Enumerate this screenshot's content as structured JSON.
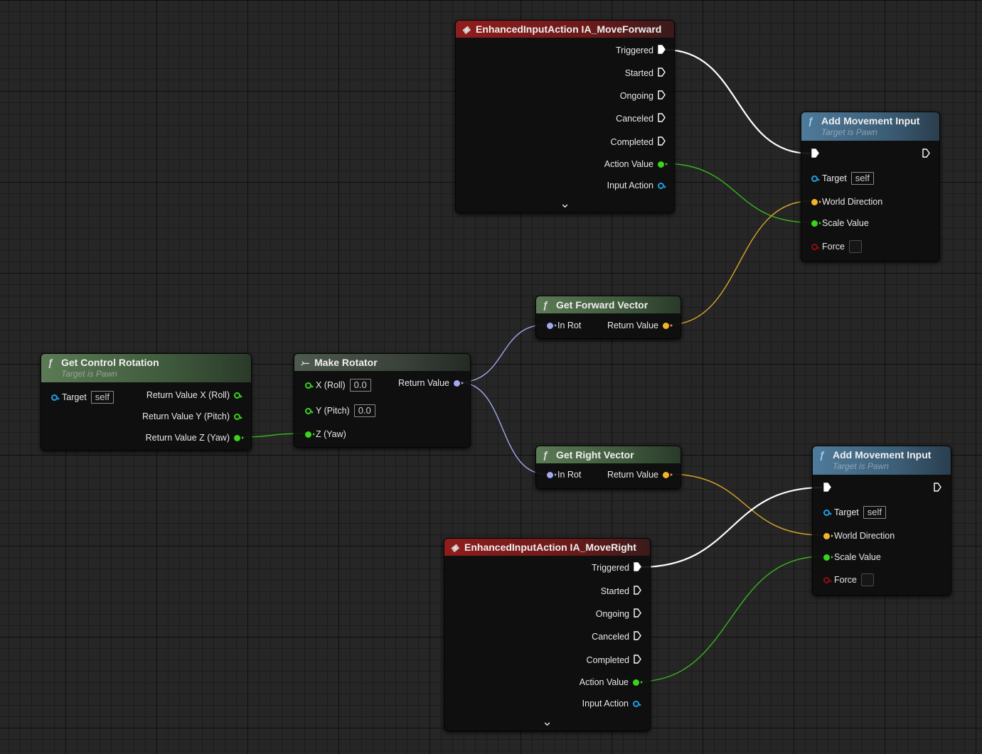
{
  "colors": {
    "exec": "#ffffff",
    "float": "#39d41c",
    "vector": "#f5b428",
    "rotator": "#a0a8f0",
    "object": "#1e9fe6",
    "bool": "#8c0f0f",
    "event_header": "#8f1d1d",
    "function_header_green": "#5b7a55",
    "function_header_blue": "#4f7a99",
    "struct_header": "#4d5a4d"
  },
  "nodes": [
    {
      "id": "move_forward",
      "kind": "event",
      "title": "EnhancedInputAction IA_MoveForward",
      "icon": "event-diamond-icon",
      "expandable": true,
      "pins": [
        {
          "dir": "out",
          "type": "exec",
          "label": "Triggered",
          "connected": true
        },
        {
          "dir": "out",
          "type": "exec",
          "label": "Started"
        },
        {
          "dir": "out",
          "type": "exec",
          "label": "Ongoing"
        },
        {
          "dir": "out",
          "type": "exec",
          "label": "Canceled"
        },
        {
          "dir": "out",
          "type": "exec",
          "label": "Completed"
        },
        {
          "dir": "out",
          "type": "float",
          "label": "Action Value",
          "connected": true
        },
        {
          "dir": "out",
          "type": "object",
          "label": "Input Action"
        }
      ]
    },
    {
      "id": "add_move_1",
      "kind": "func_blue",
      "title": "Add Movement Input",
      "subtitle": "Target is Pawn",
      "icon": "function-icon",
      "pins": [
        {
          "dir": "in",
          "type": "exec",
          "label": "",
          "connected": true
        },
        {
          "dir": "out",
          "type": "exec",
          "label": ""
        },
        {
          "dir": "in",
          "type": "object",
          "label": "Target",
          "default": "self"
        },
        {
          "dir": "in",
          "type": "vector",
          "label": "World Direction",
          "connected": true
        },
        {
          "dir": "in",
          "type": "float",
          "label": "Scale Value",
          "connected": true
        },
        {
          "dir": "in",
          "type": "bool",
          "label": "Force",
          "checkbox": true
        }
      ]
    },
    {
      "id": "fwd_vec",
      "kind": "func_green",
      "title": "Get Forward Vector",
      "icon": "function-icon",
      "pins": [
        {
          "dir": "in",
          "type": "rotator",
          "label": "In Rot",
          "connected": true
        },
        {
          "dir": "out",
          "type": "vector",
          "label": "Return Value",
          "connected": true
        }
      ]
    },
    {
      "id": "ctrl_rot",
      "kind": "func_green",
      "title": "Get Control Rotation",
      "subtitle": "Target is Pawn",
      "icon": "function-icon",
      "pins": [
        {
          "dir": "in",
          "type": "object",
          "label": "Target",
          "default": "self"
        },
        {
          "dir": "out",
          "type": "float",
          "label": "Return Value X (Roll)"
        },
        {
          "dir": "out",
          "type": "float",
          "label": "Return Value Y (Pitch)"
        },
        {
          "dir": "out",
          "type": "float",
          "label": "Return Value Z (Yaw)",
          "connected": true
        }
      ]
    },
    {
      "id": "make_rot",
      "kind": "struct",
      "title": "Make Rotator",
      "icon": "make-struct-icon",
      "pins": [
        {
          "dir": "in",
          "type": "float",
          "label": "X (Roll)",
          "default": "0.0"
        },
        {
          "dir": "in",
          "type": "float",
          "label": "Y (Pitch)",
          "default": "0.0"
        },
        {
          "dir": "in",
          "type": "float",
          "label": "Z (Yaw)",
          "connected": true
        },
        {
          "dir": "out",
          "type": "rotator",
          "label": "Return Value",
          "connected": true
        }
      ]
    },
    {
      "id": "right_vec",
      "kind": "func_green",
      "title": "Get Right Vector",
      "icon": "function-icon",
      "pins": [
        {
          "dir": "in",
          "type": "rotator",
          "label": "In Rot",
          "connected": true
        },
        {
          "dir": "out",
          "type": "vector",
          "label": "Return Value",
          "connected": true
        }
      ]
    },
    {
      "id": "add_move_2",
      "kind": "func_blue",
      "title": "Add Movement Input",
      "subtitle": "Target is Pawn",
      "icon": "function-icon",
      "pins": [
        {
          "dir": "in",
          "type": "exec",
          "label": "",
          "connected": true
        },
        {
          "dir": "out",
          "type": "exec",
          "label": ""
        },
        {
          "dir": "in",
          "type": "object",
          "label": "Target",
          "default": "self"
        },
        {
          "dir": "in",
          "type": "vector",
          "label": "World Direction",
          "connected": true
        },
        {
          "dir": "in",
          "type": "float",
          "label": "Scale Value",
          "connected": true
        },
        {
          "dir": "in",
          "type": "bool",
          "label": "Force",
          "checkbox": true
        }
      ]
    },
    {
      "id": "move_right",
      "kind": "event",
      "title": "EnhancedInputAction IA_MoveRight",
      "icon": "event-diamond-icon",
      "expandable": true,
      "pins": [
        {
          "dir": "out",
          "type": "exec",
          "label": "Triggered",
          "connected": true
        },
        {
          "dir": "out",
          "type": "exec",
          "label": "Started"
        },
        {
          "dir": "out",
          "type": "exec",
          "label": "Ongoing"
        },
        {
          "dir": "out",
          "type": "exec",
          "label": "Canceled"
        },
        {
          "dir": "out",
          "type": "exec",
          "label": "Completed"
        },
        {
          "dir": "out",
          "type": "float",
          "label": "Action Value",
          "connected": true
        },
        {
          "dir": "out",
          "type": "object",
          "label": "Input Action"
        }
      ]
    }
  ],
  "links": [
    {
      "from": "move_forward.0",
      "to": "add_move_1.0",
      "type": "exec"
    },
    {
      "from": "move_forward.5",
      "to": "add_move_1.4",
      "type": "float"
    },
    {
      "from": "fwd_vec.1",
      "to": "add_move_1.3",
      "type": "vector"
    },
    {
      "from": "ctrl_rot.3",
      "to": "make_rot.2",
      "type": "float"
    },
    {
      "from": "make_rot.3",
      "to": "fwd_vec.0",
      "type": "rotator"
    },
    {
      "from": "make_rot.3",
      "to": "right_vec.0",
      "type": "rotator"
    },
    {
      "from": "right_vec.1",
      "to": "add_move_2.3",
      "type": "vector"
    },
    {
      "from": "move_right.0",
      "to": "add_move_2.0",
      "type": "exec"
    },
    {
      "from": "move_right.5",
      "to": "add_move_2.4",
      "type": "float"
    }
  ]
}
